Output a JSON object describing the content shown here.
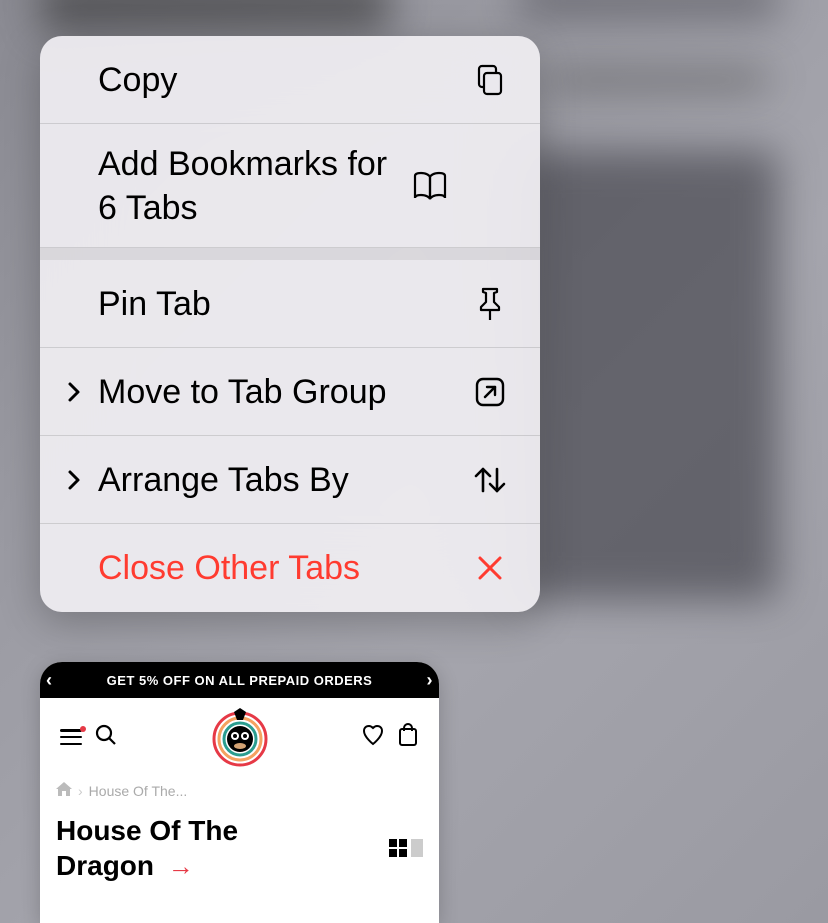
{
  "context_menu": {
    "copy": "Copy",
    "add_bookmarks": "Add Bookmarks for 6 Tabs",
    "pin_tab": "Pin Tab",
    "move_to_group": "Move to Tab Group",
    "arrange_by": "Arrange Tabs By",
    "close_others": "Close Other Tabs"
  },
  "tab_preview": {
    "banner_text": "GET 5% OFF ON ALL PREPAID ORDERS",
    "breadcrumb": "House Of The...",
    "title_line1": "House Of The",
    "title_line2": "Dragon"
  }
}
